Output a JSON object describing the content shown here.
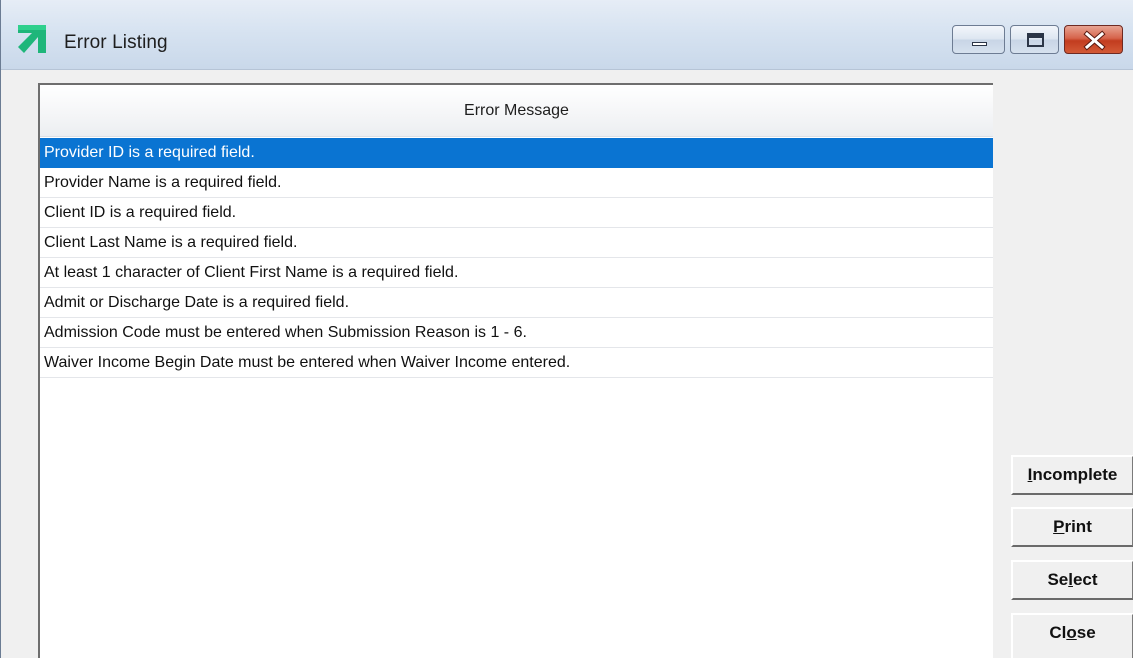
{
  "window": {
    "title": "Error Listing",
    "icon": "green-arrow-app-icon"
  },
  "list": {
    "column_header": "Error Message",
    "selected_index": 0,
    "rows": [
      "Provider ID is a required field.",
      "Provider Name is a required field.",
      "Client ID is a required field.",
      "Client Last Name is a required field.",
      "At least 1 character of Client First Name is a required field.",
      "Admit or Discharge Date is a required field.",
      "Admission Code must be entered when Submission Reason is 1 - 6.",
      "Waiver Income Begin Date must be entered when Waiver Income entered."
    ]
  },
  "buttons": {
    "incomplete": {
      "pre": "",
      "hot": "I",
      "post": "ncomplete"
    },
    "print": {
      "pre": "",
      "hot": "P",
      "post": "rint"
    },
    "select": {
      "pre": "Se",
      "hot": "l",
      "post": "ect"
    },
    "close": {
      "pre": "Cl",
      "hot": "o",
      "post": "se"
    }
  },
  "colors": {
    "selection": "#0a74d2",
    "close_button": "#c23c1f",
    "icon_green": "#1fb67a"
  }
}
